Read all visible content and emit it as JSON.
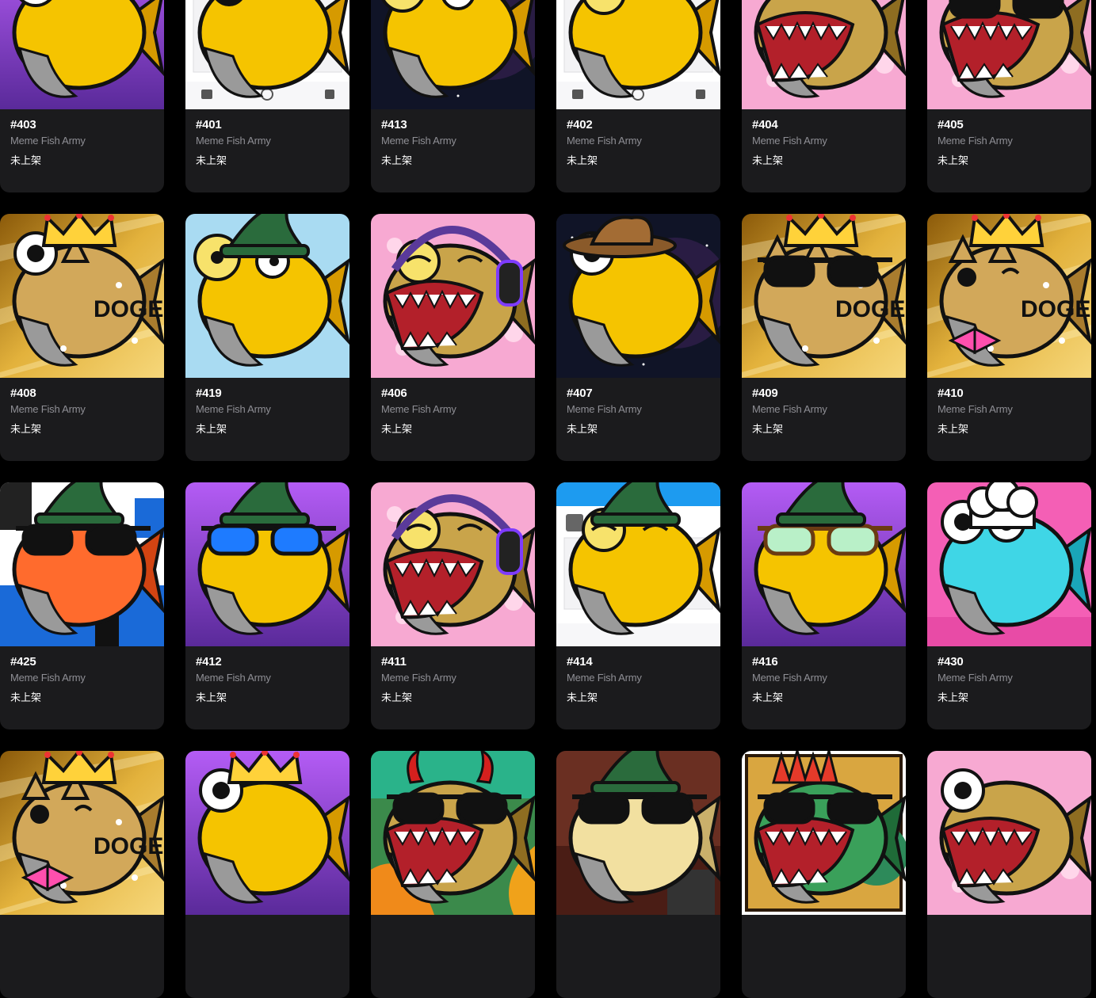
{
  "collection_name": "Meme Fish Army",
  "listing_status": "未上架",
  "colors": {
    "page_bg": "#000000",
    "card_bg": "#1b1b1d",
    "title_text": "#ffffff",
    "subtitle_text": "#8f8f95"
  },
  "cards": [
    {
      "number": "#403",
      "bg": "purple",
      "fish": "gold",
      "accessory": "none",
      "eyes": "big"
    },
    {
      "number": "#401",
      "bg": "social",
      "fish": "gold",
      "accessory": "wizard-hat",
      "eyes": "eyepatch"
    },
    {
      "number": "#413",
      "bg": "space",
      "fish": "gold",
      "accessory": "none",
      "eyes": "monocle"
    },
    {
      "number": "#402",
      "bg": "social",
      "fish": "gold",
      "accessory": "wizard-hat",
      "eyes": "squint"
    },
    {
      "number": "#404",
      "bg": "pink",
      "fish": "gold-shark",
      "accessory": "none",
      "eyes": "angry"
    },
    {
      "number": "#405",
      "bg": "pink",
      "fish": "gold-shark",
      "accessory": "none",
      "eyes": "shades"
    },
    {
      "number": "#408",
      "bg": "goldrays",
      "fish": "doge",
      "accessory": "crown",
      "eyes": "big"
    },
    {
      "number": "#419",
      "bg": "lightblue",
      "fish": "gold",
      "accessory": "wizard-hat",
      "eyes": "monocle"
    },
    {
      "number": "#406",
      "bg": "pink",
      "fish": "gold-shark",
      "accessory": "headphones",
      "eyes": "squint"
    },
    {
      "number": "#407",
      "bg": "space",
      "fish": "gold",
      "accessory": "cowboy-hat",
      "eyes": "big"
    },
    {
      "number": "#409",
      "bg": "goldrays",
      "fish": "doge",
      "accessory": "crown",
      "eyes": "shades"
    },
    {
      "number": "#410",
      "bg": "goldrays",
      "fish": "doge",
      "accessory": "crown",
      "eyes": "bow"
    },
    {
      "number": "#425",
      "bg": "pixel",
      "fish": "orange",
      "accessory": "wizard-hat",
      "eyes": "shades"
    },
    {
      "number": "#412",
      "bg": "purple",
      "fish": "gold",
      "accessory": "wizard-hat",
      "eyes": "blue-shades"
    },
    {
      "number": "#411",
      "bg": "pink",
      "fish": "gold-shark",
      "accessory": "headphones",
      "eyes": "squint"
    },
    {
      "number": "#414",
      "bg": "twitter",
      "fish": "gold",
      "accessory": "wizard-hat",
      "eyes": "squint"
    },
    {
      "number": "#416",
      "bg": "purple",
      "fish": "gold",
      "accessory": "wizard-hat",
      "eyes": "glasses"
    },
    {
      "number": "#430",
      "bg": "pinkhot",
      "fish": "cyan",
      "accessory": "chef-hat",
      "eyes": "big"
    },
    {
      "number": "",
      "bg": "goldrays",
      "fish": "doge",
      "accessory": "crown",
      "eyes": "bow"
    },
    {
      "number": "",
      "bg": "purple",
      "fish": "gold",
      "accessory": "crown",
      "eyes": "big"
    },
    {
      "number": "",
      "bg": "jungle",
      "fish": "gold-shark",
      "accessory": "devil-horns",
      "eyes": "shades"
    },
    {
      "number": "",
      "bg": "brown",
      "fish": "pale",
      "accessory": "wizard-hat",
      "eyes": "shades"
    },
    {
      "number": "",
      "bg": "framed",
      "fish": "green-shark",
      "accessory": "mohawk",
      "eyes": "shades"
    },
    {
      "number": "",
      "bg": "pink",
      "fish": "gold-shark",
      "accessory": "none",
      "eyes": "big"
    }
  ]
}
